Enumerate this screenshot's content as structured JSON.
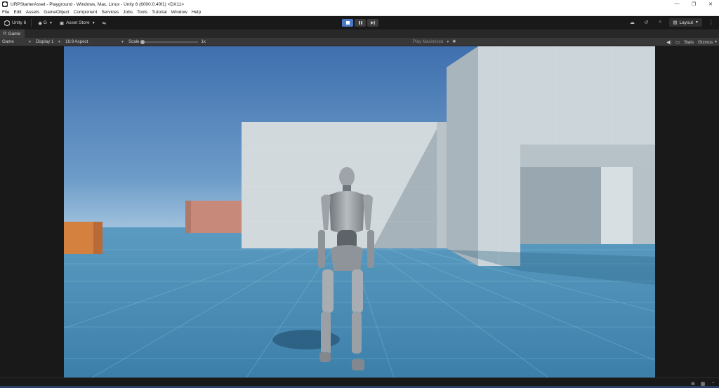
{
  "window": {
    "title": "URPStarterAsset - Playground - Windows, Mac, Linux - Unity 6 (6000.0.40f1) <DX11>"
  },
  "menu": {
    "items": [
      "File",
      "Edit",
      "Assets",
      "GameObject",
      "Component",
      "Services",
      "Jobs",
      "Tools",
      "Tutorial",
      "Window",
      "Help"
    ]
  },
  "toolbar": {
    "unity_label": "Unity 6",
    "account_label": "G",
    "asset_store_label": "Asset Store",
    "layout_label": "Layout"
  },
  "tabs": {
    "game_label": "Game"
  },
  "gamebar": {
    "mode_label": "Game",
    "display_label": "Display 1",
    "aspect_label": "16:9 Aspect",
    "scale_label": "Scale",
    "scale_value": "1x",
    "play_mode_label": "Play Maximized",
    "stats_label": "Stats",
    "gizmos_label": "Gizmos"
  },
  "colors": {
    "sky_top": "#3f77b6",
    "sky_bottom": "#8fb6d4",
    "floor": "#3f86ad",
    "wall": "#cfd8dc",
    "orange_box": "#d9844d",
    "pink_box": "#c88a7c",
    "accent_play": "#4a79c8"
  }
}
